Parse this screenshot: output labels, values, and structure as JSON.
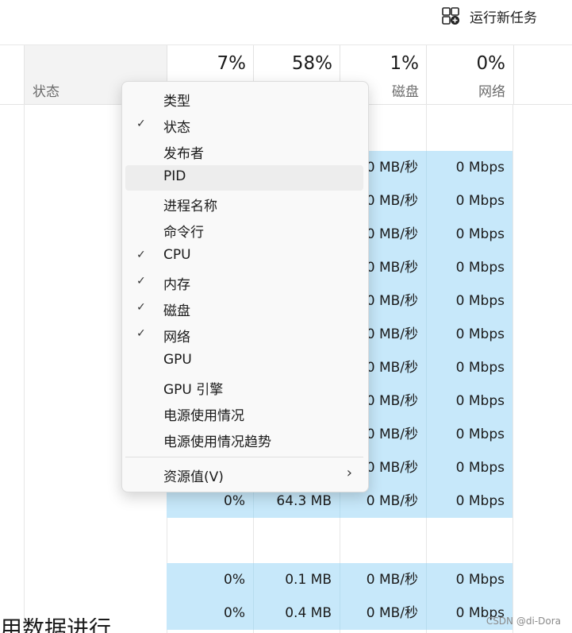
{
  "toolbar": {
    "run_new_task": "运行新任务",
    "run_icon": "new-task-icon"
  },
  "header": {
    "status": "状态",
    "cpu": {
      "percent": "7%"
    },
    "memory": {
      "percent": "58%"
    },
    "disk": {
      "percent": "1%",
      "label": "磁盘"
    },
    "network": {
      "percent": "0%",
      "label": "网络"
    }
  },
  "rows": [
    {
      "cpu": "",
      "memory": "",
      "disk": "0 MB/秒",
      "network": "0 Mbps"
    },
    {
      "cpu": "",
      "memory": "",
      "disk": "0 MB/秒",
      "network": "0 Mbps"
    },
    {
      "cpu": "",
      "memory": "",
      "disk": "0 MB/秒",
      "network": "0 Mbps"
    },
    {
      "cpu": "",
      "memory": "",
      "disk": "0 MB/秒",
      "network": "0 Mbps"
    },
    {
      "cpu": "",
      "memory": "",
      "disk": "0 MB/秒",
      "network": "0 Mbps"
    },
    {
      "cpu": "",
      "memory": "",
      "disk": "0 MB/秒",
      "network": "0 Mbps"
    },
    {
      "cpu": "",
      "memory": "",
      "disk": "0 MB/秒",
      "network": "0 Mbps"
    },
    {
      "cpu": "",
      "memory": "",
      "disk": "0 MB/秒",
      "network": "0 Mbps"
    },
    {
      "cpu": "",
      "memory": "",
      "disk": "0 MB/秒",
      "network": "0 Mbps"
    },
    {
      "cpu": "",
      "memory": "",
      "disk": "0 MB/秒",
      "network": "0 Mbps"
    },
    {
      "cpu": "0%",
      "memory": "64.3 MB",
      "disk": "0 MB/秒",
      "network": "0 Mbps"
    },
    {
      "cpu": "0%",
      "memory": "0.1 MB",
      "disk": "0 MB/秒",
      "network": "0 Mbps"
    },
    {
      "cpu": "0%",
      "memory": "0.4 MB",
      "disk": "0 MB/秒",
      "network": "0 Mbps"
    }
  ],
  "context_menu": {
    "items": [
      {
        "label": "类型",
        "checked": false
      },
      {
        "label": "状态",
        "checked": true
      },
      {
        "label": "发布者",
        "checked": false
      },
      {
        "label": "PID",
        "checked": false,
        "hover": true
      },
      {
        "label": "进程名称",
        "checked": false
      },
      {
        "label": "命令行",
        "checked": false
      },
      {
        "label": "CPU",
        "checked": true
      },
      {
        "label": "内存",
        "checked": true
      },
      {
        "label": "磁盘",
        "checked": true
      },
      {
        "label": "网络",
        "checked": true
      },
      {
        "label": "GPU",
        "checked": false
      },
      {
        "label": "GPU 引擎",
        "checked": false
      },
      {
        "label": "电源使用情况",
        "checked": false
      },
      {
        "label": "电源使用情况趋势",
        "checked": false
      }
    ],
    "submenu_item": {
      "label": "资源值(V)"
    },
    "check_glyph": "✓",
    "arrow_glyph": "›"
  },
  "bottom_text": "用数据进行",
  "watermark": "CSDN @di-Dora"
}
